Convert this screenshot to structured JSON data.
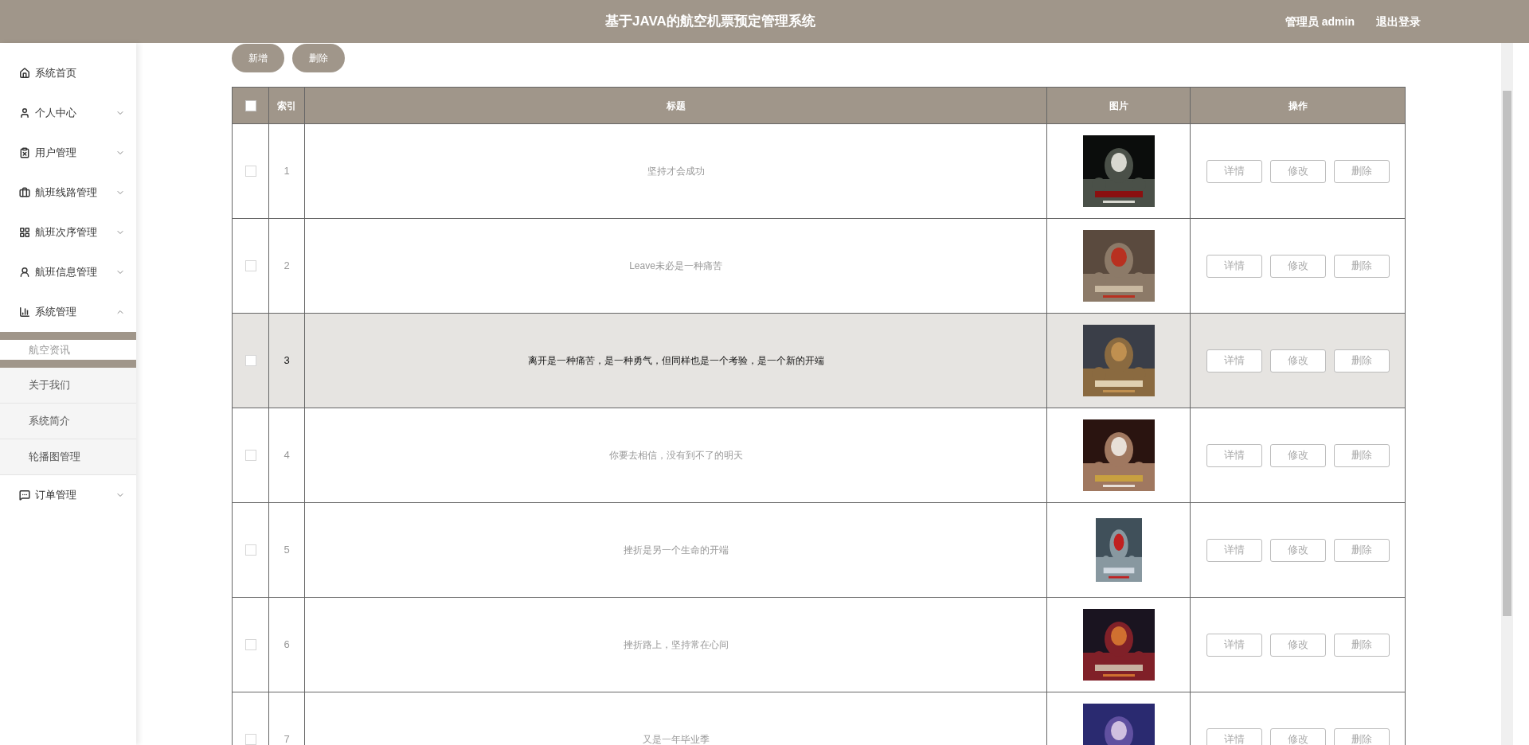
{
  "header": {
    "title": "基于JAVA的航空机票预定管理系统",
    "user": "管理员 admin",
    "logout": "退出登录"
  },
  "sidebar": {
    "items": [
      {
        "label": "系统首页",
        "kind": "link"
      },
      {
        "label": "个人中心",
        "kind": "menu",
        "expanded": false
      },
      {
        "label": "用户管理",
        "kind": "menu",
        "expanded": false
      },
      {
        "label": "航班线路管理",
        "kind": "menu",
        "expanded": false
      },
      {
        "label": "航班次序管理",
        "kind": "menu",
        "expanded": false
      },
      {
        "label": "航班信息管理",
        "kind": "menu",
        "expanded": false
      },
      {
        "label": "系统管理",
        "kind": "menu",
        "expanded": true,
        "children": [
          {
            "label": "航空资讯",
            "selected": true
          },
          {
            "label": "关于我们",
            "selected": false
          },
          {
            "label": "系统简介",
            "selected": false
          },
          {
            "label": "轮播图管理",
            "selected": false
          }
        ]
      },
      {
        "label": "订单管理",
        "kind": "menu",
        "expanded": false
      }
    ]
  },
  "toolbar": [
    "新增",
    "删除"
  ],
  "table": {
    "select_all": {
      "checked": false
    },
    "columns": [
      "索引",
      "标题",
      "图片",
      "操作"
    ],
    "rows": [
      {
        "index": "1",
        "title": "坚持才会成功",
        "checked": false,
        "highlighted": false,
        "actions": [
          "详情",
          "修改",
          "删除"
        ]
      },
      {
        "index": "2",
        "title": "Leave未必是一种痛苦",
        "checked": false,
        "highlighted": false,
        "actions": [
          "详情",
          "修改",
          "删除"
        ]
      },
      {
        "index": "3",
        "title": "离开是一种痛苦，是一种勇气，但同样也是一个考验，是一个新的开端",
        "checked": false,
        "highlighted": true,
        "actions": [
          "详情",
          "修改",
          "删除"
        ]
      },
      {
        "index": "4",
        "title": "你要去相信，没有到不了的明天",
        "checked": false,
        "highlighted": false,
        "actions": [
          "详情",
          "修改",
          "删除"
        ]
      },
      {
        "index": "5",
        "title": "挫折是另一个生命的开端",
        "checked": false,
        "highlighted": false,
        "actions": [
          "详情",
          "修改",
          "删除"
        ]
      },
      {
        "index": "6",
        "title": "挫折路上，坚持常在心间",
        "checked": false,
        "highlighted": false,
        "actions": [
          "详情",
          "修改",
          "删除"
        ]
      },
      {
        "index": "7",
        "title": "又是一年毕业季",
        "checked": false,
        "highlighted": false,
        "actions": [
          "详情",
          "修改",
          "删除"
        ]
      }
    ]
  }
}
